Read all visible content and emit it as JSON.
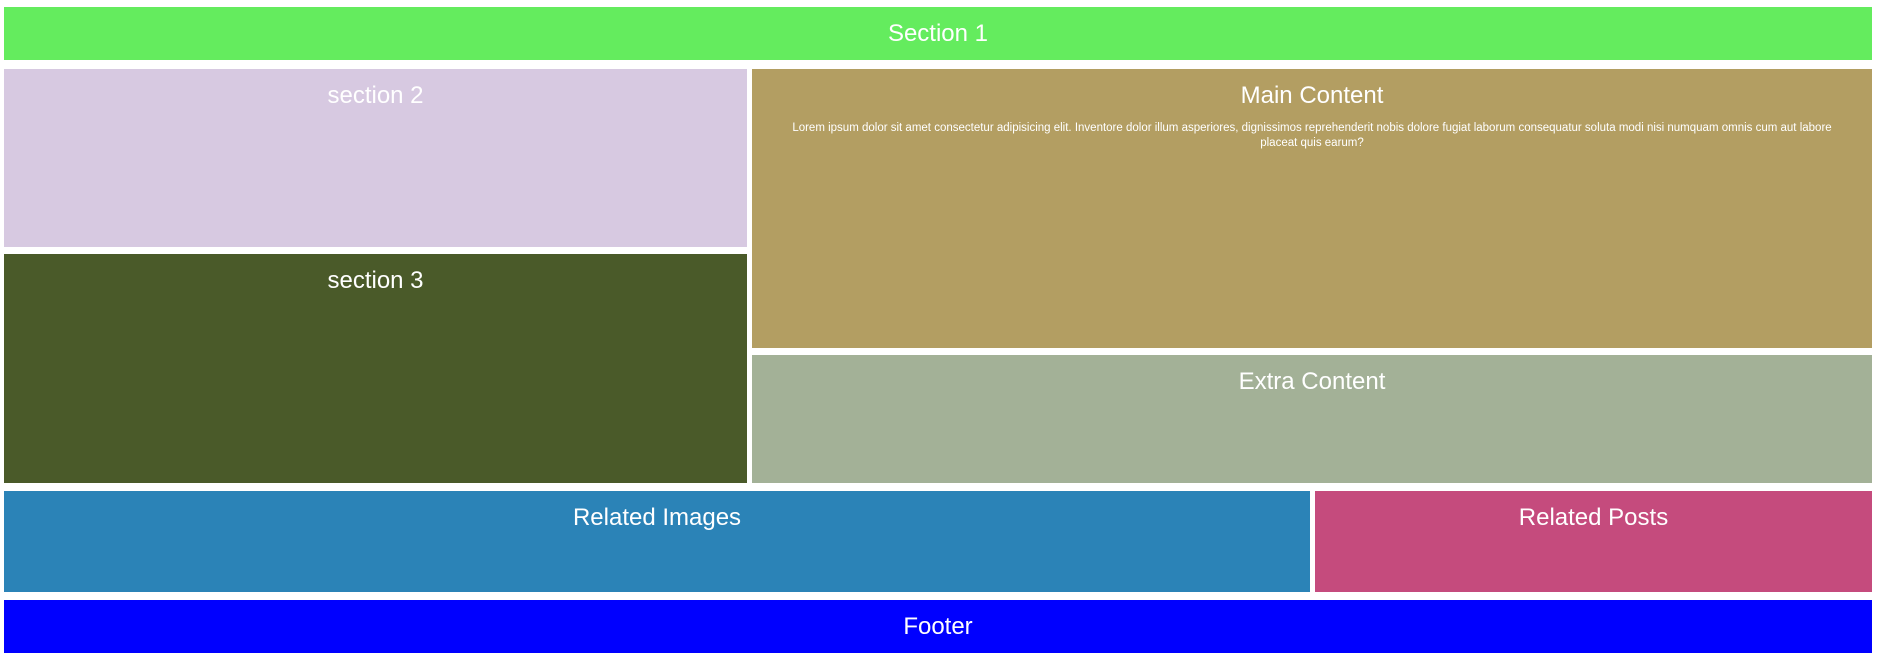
{
  "section1": {
    "title": "Section 1",
    "color": "#64ec5e"
  },
  "section2": {
    "title": "section 2",
    "color": "#d7c9e1"
  },
  "section3": {
    "title": "section 3",
    "color": "#4a5a29"
  },
  "main": {
    "title": "Main Content",
    "body": "Lorem ipsum dolor sit amet consectetur adipisicing elit. Inventore dolor illum asperiores, dignissimos reprehenderit nobis dolore fugiat laborum consequatur soluta modi nisi numquam omnis cum aut labore placeat quis earum?",
    "color": "#b39e62"
  },
  "extra": {
    "title": "Extra Content",
    "color": "#a3b197"
  },
  "related_images": {
    "title": "Related Images",
    "color": "#2b83b7"
  },
  "related_posts": {
    "title": "Related Posts",
    "color": "#c54b7d"
  },
  "footer": {
    "title": "Footer",
    "color": "#0000ff"
  }
}
